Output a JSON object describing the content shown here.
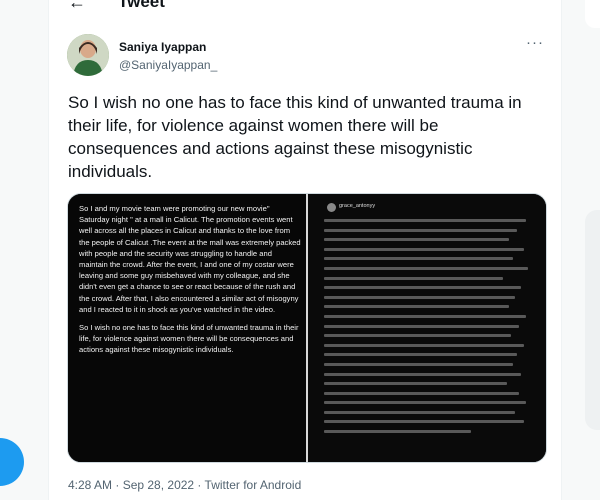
{
  "header": {
    "back_icon": "arrow-left-icon",
    "title": "Tweet"
  },
  "tweet": {
    "author_name": "Saniya Iyappan",
    "author_handle": "@SaniyaIyappan_",
    "more_icon": "more-horizontal-icon",
    "text": "So I wish no one has to face this kind of unwanted trauma in their life, for violence against women there will be consequences and actions against these misogynistic individuals.",
    "media": {
      "left_caption": [
        "So I and my movie team were promoting our new movie\" Saturday night \" at a mall in Calicut. The promotion events went well across all the places in Calicut and thanks to the love from the people of Calicut .The event at the mall was extremely packed with people and the security was struggling to handle and maintain the crowd. After the event, I and one of my costar were leaving and some guy misbehaved with my colleague, and she didn't even get a chance to see or react because of the rush and the crowd. After that, I also encountered a similar act of misogyny and I reacted to it in shock as you've watched in the video.",
        "So I wish no one has to face this kind of unwanted trauma in their life, for violence against women there will be consequences and actions against these misogynistic individuals."
      ],
      "right_username": "grace_antonyy"
    },
    "timestamp": "4:28 AM · Sep 28, 2022 · Twitter for Android"
  },
  "colors": {
    "accent": "#1d9bf0",
    "text_primary": "#0f1419",
    "text_secondary": "#536471"
  }
}
